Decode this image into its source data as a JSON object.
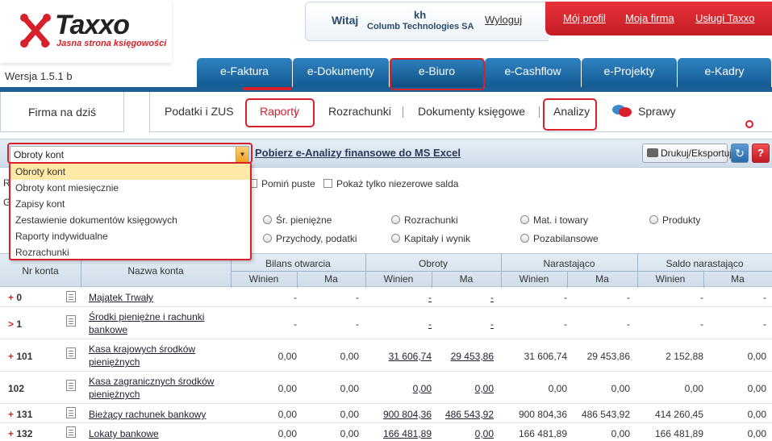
{
  "logo": {
    "name": "Taxxo",
    "tagline": "Jasna strona księgowości"
  },
  "version": "Wersja 1.5.1 b",
  "user": {
    "welcome": "Witaj",
    "initials": "kh",
    "company": "Columb Technologies SA",
    "logout": "Wyloguj"
  },
  "top_links": [
    "Mój profil",
    "Moja firma",
    "Usługi Taxxo"
  ],
  "main_tabs": [
    "e-Faktura",
    "e-Dokumenty",
    "e-Biuro",
    "e-Cashflow",
    "e-Projekty",
    "e-Kadry"
  ],
  "firma_label": "Firma na dziś",
  "sub_nav": [
    "Podatki i ZUS",
    "Raporty",
    "Rozrachunki",
    "Dokumenty księgowe",
    "Analizy",
    "Sprawy"
  ],
  "toolbar": {
    "select_value": "Obroty kont",
    "excel_link": "Pobierz e-Analizy finansowe do MS Excel",
    "print_label": "Drukuj/Eksportuj",
    "refresh_icon": "↻",
    "help_icon": "?"
  },
  "dropdown_options": [
    "Obroty kont",
    "Obroty kont miesięcznie",
    "Zapisy kont",
    "Zestawienie dokumentów księgowych",
    "Raporty indywidualne",
    "Rozrachunki"
  ],
  "options": {
    "row1_letter": "R",
    "row2_letter": "G",
    "checkboxes": [
      "Pomiń puste",
      "Pokaż tylko niezerowe salda"
    ],
    "radios": [
      "Śr. pieniężne",
      "Rozrachunki",
      "Mat. i towary",
      "Produkty",
      "Przychody, podatki",
      "Kapitały i wynik",
      "Pozabilansowe"
    ]
  },
  "table": {
    "headers": {
      "nr": "Nr konta",
      "name": "Nazwa konta",
      "groups": [
        "Bilans otwarcia",
        "Obroty",
        "Narastająco",
        "Saldo narastająco"
      ],
      "sub": [
        "Winien",
        "Ma"
      ]
    },
    "rows": [
      {
        "prefix": "+",
        "nr": "0",
        "name": "Majątek Trwały",
        "vals": [
          "-",
          "-",
          "-",
          "-",
          "-",
          "-",
          "-",
          "-"
        ]
      },
      {
        "prefix": ">",
        "nr": "1",
        "name": "Środki pieniężne i rachunki bankowe",
        "vals": [
          "-",
          "-",
          "-",
          "-",
          "-",
          "-",
          "-",
          "-"
        ]
      },
      {
        "prefix": "+",
        "nr": "101",
        "name": "Kasa krajowych środków pieniężnych",
        "vals": [
          "0,00",
          "0,00",
          "31 606,74",
          "29 453,86",
          "31 606,74",
          "29 453,86",
          "2 152,88",
          "0,00"
        ]
      },
      {
        "prefix": "",
        "nr": "102",
        "name": "Kasa zagranicznych środków pieniężnych",
        "vals": [
          "0,00",
          "0,00",
          "0,00",
          "0,00",
          "0,00",
          "0,00",
          "0,00",
          "0,00"
        ]
      },
      {
        "prefix": "+",
        "nr": "131",
        "name": "Bieżący rachunek bankowy",
        "vals": [
          "0,00",
          "0,00",
          "900 804,36",
          "486 543,92",
          "900 804,36",
          "486 543,92",
          "414 260,45",
          "0,00"
        ]
      },
      {
        "prefix": "+",
        "nr": "132",
        "name": "Lokaty bankowe",
        "vals": [
          "0,00",
          "0,00",
          "166 481,89",
          "0,00",
          "166 481,89",
          "0,00",
          "166 481,89",
          "0,00"
        ]
      }
    ]
  },
  "colors": {
    "accent_red": "#d8202a",
    "tab_blue": "#1d6aa8",
    "header_bg": "#dce6ef"
  }
}
